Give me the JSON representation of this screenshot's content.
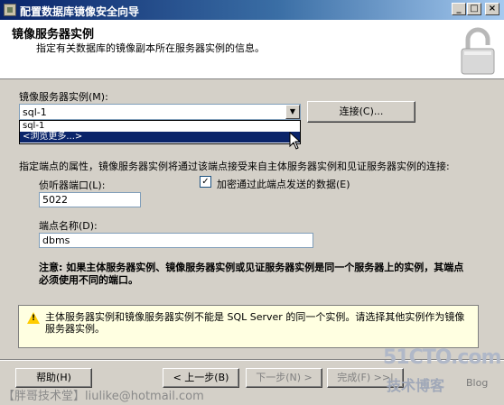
{
  "window": {
    "title": "配置数据库镜像安全向导",
    "min_label": "_",
    "max_label": "□",
    "close_label": "×"
  },
  "header": {
    "title": "镜像服务器实例",
    "subtitle": "指定有关数据库的镜像副本所在服务器实例的信息。"
  },
  "mirror_instance": {
    "label": "镜像服务器实例(M):",
    "selected": "sql-1",
    "options": [
      "sql-1",
      "<浏览更多...>"
    ],
    "connect_label": "连接(C)..."
  },
  "endpoint": {
    "description": "指定端点的属性，镜像服务器实例将通过该端点接受来自主体服务器实例和见证服务器实例的连接:",
    "port_label": "侦听器端口(L):",
    "port_value": "5022",
    "encrypt_label": "加密通过此端点发送的数据(E)",
    "encrypt_checked": true,
    "name_label": "端点名称(D):",
    "name_value": "dbms"
  },
  "note": "注意: 如果主体服务器实例、镜像服务器实例或见证服务器实例是同一个服务器上的实例，其端点必须使用不同的端口。",
  "warning": "主体服务器实例和镜像服务器实例不能是 SQL Server 的同一个实例。请选择其他实例作为镜像服务器实例。",
  "footer": {
    "help": "帮助(H)",
    "prev": "< 上一步(B)",
    "next": "下一步(N) >",
    "finish": "完成(F) >>|"
  },
  "watermark": {
    "left": "【胖哥技术堂】liulike@hotmail.com",
    "logo": "51CTO.com",
    "cn": "技术博客",
    "blog": "Blog"
  }
}
